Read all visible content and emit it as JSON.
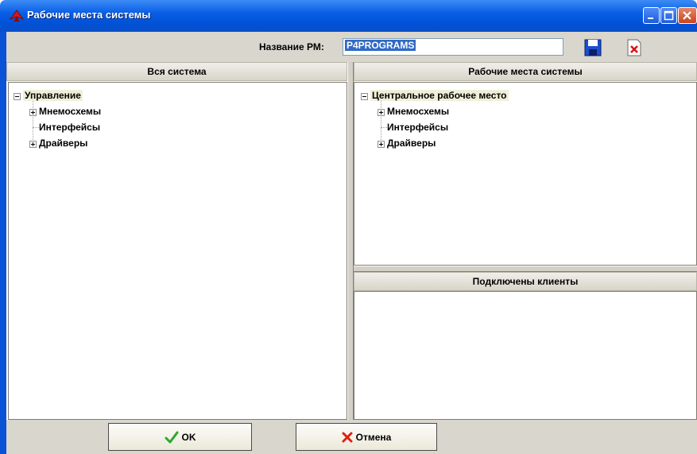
{
  "window": {
    "title": "Рабочие места системы"
  },
  "toolbar": {
    "name_label": "Название РМ:",
    "name_value": "P4PROGRAMS"
  },
  "left_panel": {
    "header": "Вся система",
    "tree": {
      "root": "Управление",
      "children": [
        "Мнемосхемы",
        "Интерфейсы",
        "Драйверы"
      ]
    }
  },
  "right_panel": {
    "header": "Рабочие места системы",
    "tree": {
      "root": "Центральное рабочее место",
      "children": [
        "Мнемосхемы",
        "Интерфейсы",
        "Драйверы"
      ]
    }
  },
  "clients_panel": {
    "header": "Подключены клиенты"
  },
  "buttons": {
    "ok": "OK",
    "cancel": "Отмена"
  }
}
